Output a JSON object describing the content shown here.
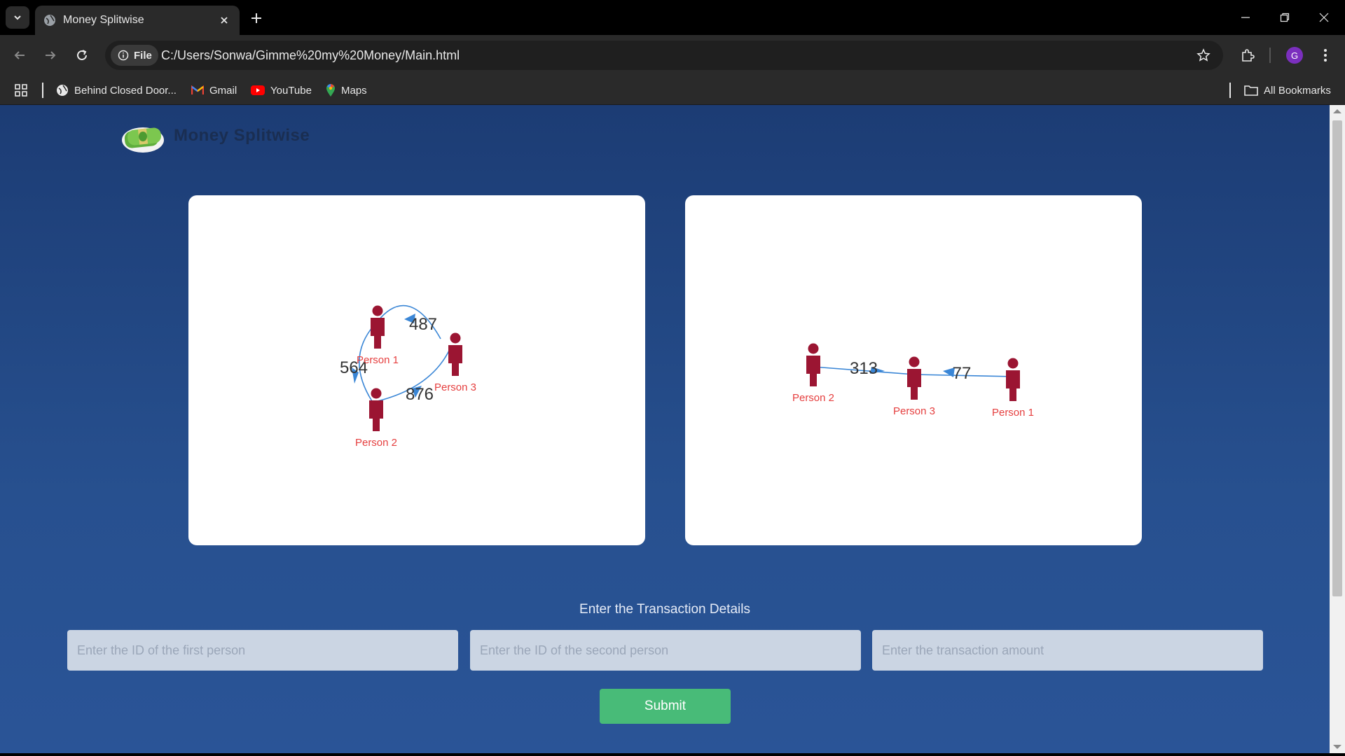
{
  "browser": {
    "tab_title": "Money Splitwise",
    "site_chip": "File",
    "url": "C:/Users/Sonwa/Gimme%20my%20Money/Main.html",
    "avatar_letter": "G",
    "bookmarks": [
      "Behind Closed Door...",
      "Gmail",
      "YouTube",
      "Maps"
    ],
    "all_bookmarks": "All Bookmarks"
  },
  "app": {
    "brand": "Money Splitwise"
  },
  "graph_left": {
    "nodes": [
      {
        "label": "Person 1"
      },
      {
        "label": "Person 3"
      },
      {
        "label": "Person 2"
      }
    ],
    "edges": [
      {
        "from": "Person 3",
        "to": "Person 1",
        "amount": "487"
      },
      {
        "from": "Person 1",
        "to": "Person 2",
        "amount": "564"
      },
      {
        "from": "Person 3",
        "to": "Person 2",
        "amount": "876"
      }
    ]
  },
  "graph_right": {
    "nodes": [
      {
        "label": "Person 2"
      },
      {
        "label": "Person 3"
      },
      {
        "label": "Person 1"
      }
    ],
    "edges": [
      {
        "from": "Person 2",
        "to": "Person 3",
        "amount": "313"
      },
      {
        "from": "Person 1",
        "to": "Person 3",
        "amount": "77"
      }
    ]
  },
  "form": {
    "title": "Enter the Transaction Details",
    "first_placeholder": "Enter the ID of the first person",
    "second_placeholder": "Enter the ID of the second person",
    "amount_placeholder": "Enter the transaction amount",
    "submit_label": "Submit"
  },
  "colors": {
    "page_bg": "#1c3c74",
    "node": "#9b1532",
    "node_label": "#e53e3e",
    "edge": "#3a86d6",
    "submit": "#48bb78"
  }
}
